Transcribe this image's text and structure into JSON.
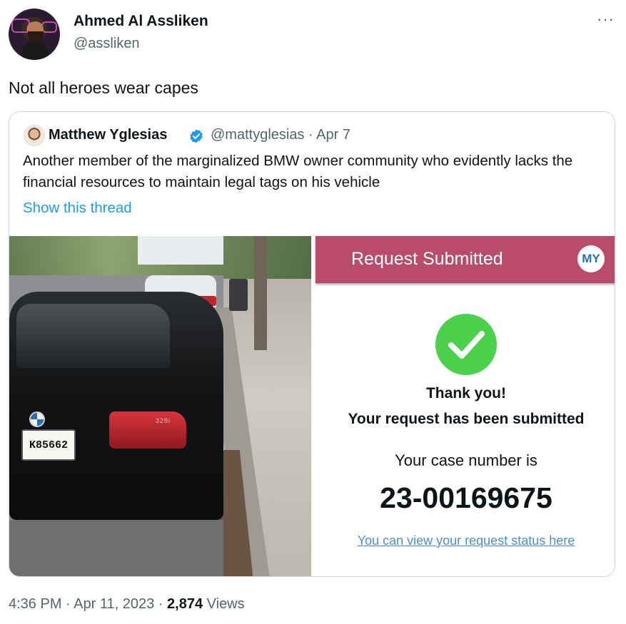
{
  "author": {
    "name": "Ahmed Al Assliken",
    "handle": "@assliken",
    "avatar_icon": "user-avatar"
  },
  "more_label": "···",
  "tweet_text": "Not all heroes wear capes",
  "quoted": {
    "name": "Matthew Yglesias",
    "verified": true,
    "verified_color": "#1d9bf0",
    "handle": "@mattyglesias",
    "separator": "·",
    "date": "Apr 7",
    "text": "Another member of the marginalized BMW owner community who evidently lacks the financial resources to maintain legal tags on his vehicle",
    "show_thread": "Show this thread",
    "photo": {
      "plate_text": "K85662",
      "badge_text": "328i"
    },
    "screenshot": {
      "header_title": "Request Submitted",
      "header_color": "#b94c6d",
      "user_initials": "MY",
      "check_color": "#4cd14c",
      "thanks": "Thank you!",
      "submitted": "Your request has been submitted",
      "case_label": "Your case number is",
      "case_number": "23-00169675",
      "status_link": "You can view your request status here"
    }
  },
  "footer": {
    "time": "4:36 PM",
    "separator": "·",
    "date": "Apr 11, 2023",
    "views_count": "2,874",
    "views_label": "Views"
  }
}
